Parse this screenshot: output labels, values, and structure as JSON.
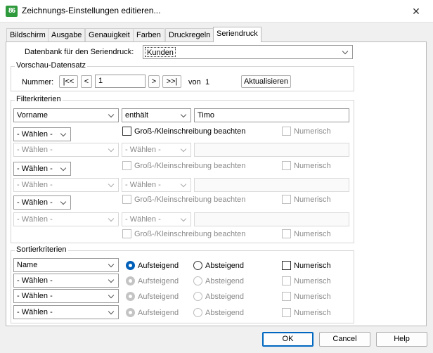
{
  "window": {
    "app_icon": "86",
    "title": "Zeichnungs-Einstellungen editieren...",
    "close_glyph": "✕"
  },
  "tabs": [
    "Bildschirm",
    "Ausgabe",
    "Genauigkeit",
    "Farben",
    "Druckregeln",
    "Seriendruck"
  ],
  "active_tab": "Seriendruck",
  "database": {
    "label": "Datenbank für den Seriendruck:",
    "value": "Kunden"
  },
  "preview": {
    "title": "Vorschau-Datensatz",
    "number_label": "Nummer:",
    "first": "|<<",
    "prev": "<",
    "value": "1",
    "next": ">",
    "last": ">>|",
    "of_label": "von",
    "total": "1",
    "refresh": "Aktualisieren"
  },
  "filter": {
    "title": "Filterkriterien",
    "field1": "Vorname",
    "op1": "enthält",
    "value1": "Timo",
    "choose": "- Wählen -",
    "case_label": "Groß-/Kleinschreibung beachten",
    "numeric_label": "Numerisch"
  },
  "sort": {
    "title": "Sortierkriterien",
    "field1": "Name",
    "choose": "- Wählen -",
    "asc": "Aufsteigend",
    "desc": "Absteigend",
    "numeric": "Numerisch"
  },
  "footer": {
    "ok": "OK",
    "cancel": "Cancel",
    "help": "Help"
  }
}
